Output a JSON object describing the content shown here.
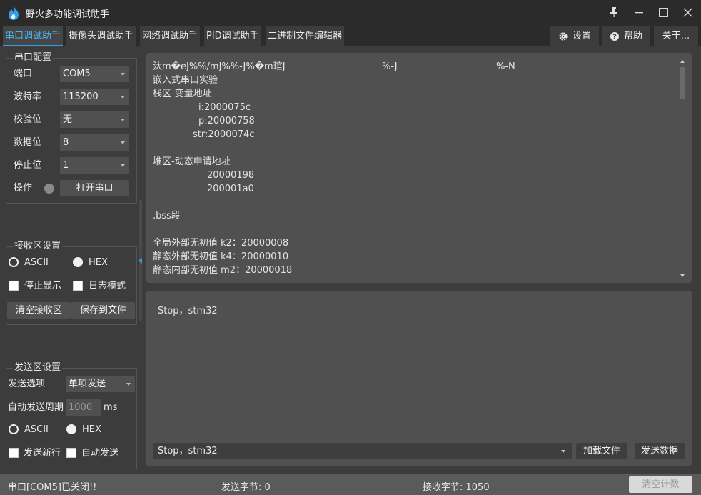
{
  "window": {
    "title": "野火多功能调试助手",
    "icons": [
      "fire-logo-icon",
      "pin-icon",
      "minimize-icon",
      "maximize-icon",
      "close-icon"
    ]
  },
  "tabs": [
    {
      "label": "串口调试助手",
      "active": true
    },
    {
      "label": "摄像头调试助手",
      "active": false
    },
    {
      "label": "网络调试助手",
      "active": false
    },
    {
      "label": "PID调试助手",
      "active": false
    },
    {
      "label": "二进制文件编辑器",
      "active": false
    }
  ],
  "toolbar": {
    "settings": "设置",
    "help": "帮助",
    "about": "关于..."
  },
  "serial_config": {
    "title": "串口配置",
    "port_label": "端口",
    "port_value": "COM5",
    "baud_label": "波特率",
    "baud_value": "115200",
    "parity_label": "校验位",
    "parity_value": "无",
    "databits_label": "数据位",
    "databits_value": "8",
    "stopbits_label": "停止位",
    "stopbits_value": "1",
    "operate_label": "操作",
    "open_button": "打开串口"
  },
  "recv_settings": {
    "title": "接收区设置",
    "ascii": "ASCII",
    "hex": "HEX",
    "stop_display": "停止显示",
    "log_mode": "日志模式",
    "clear_button": "清空接收区",
    "save_button": "保存到文件"
  },
  "send_settings": {
    "title": "发送区设置",
    "option_label": "发送选项",
    "option_value": "单项发送",
    "period_label": "自动发送周期",
    "period_value": "1000",
    "period_unit": "ms",
    "ascii": "ASCII",
    "hex": "HEX",
    "newline": "发送新行",
    "auto_send": "自动发送"
  },
  "recv_area": {
    "line1": "汏m�eJ%%/mJ%%-J%�m琯J",
    "line1_b": "%-J",
    "line1_c": "%-N",
    "line2": "嵌入式串口实验",
    "line3": "栈区-变量地址",
    "line4": "i:2000075c",
    "line5": "p:20000758",
    "line6": "str:2000074c",
    "line7": "堆区-动态申请地址",
    "line8": "20000198",
    "line9": "200001a0",
    "line10": ".bss段",
    "line11": "全局外部无初值 k2：20000008",
    "line12": "静态外部无初值 k4：20000010",
    "line13": "静态内部无初值 m2：20000018"
  },
  "send_area": {
    "text": "Stop，stm32",
    "history_value": "Stop，stm32",
    "load_file": "加载文件",
    "send_data": "发送数据"
  },
  "status": {
    "port_status": "串口[COM5]已关闭!!",
    "sent_bytes": "发送字节: 0",
    "recv_bytes": "接收字节: 1050",
    "clear_count": "清空计数"
  }
}
